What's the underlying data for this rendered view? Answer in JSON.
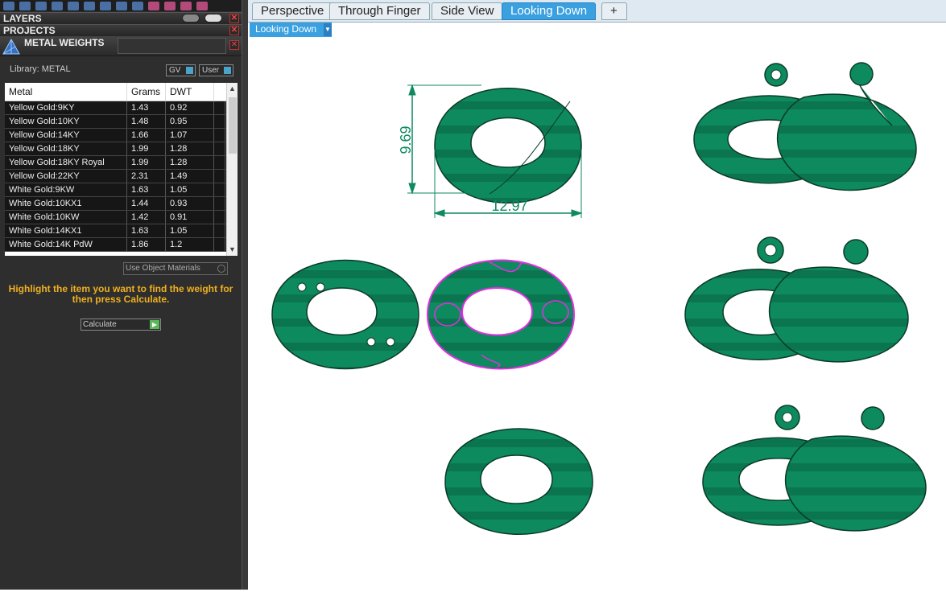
{
  "panels": {
    "layers": "LAYERS",
    "projects": "PROJECTS",
    "metal_weights": "METAL WEIGHTS"
  },
  "library": {
    "label": "Library: METAL",
    "gv": "GV",
    "user": "User"
  },
  "table": {
    "headers": [
      "Metal",
      "Grams",
      "DWT"
    ],
    "rows": [
      [
        "Yellow Gold:9KY",
        "1.43",
        "0.92"
      ],
      [
        "Yellow Gold:10KY",
        "1.48",
        "0.95"
      ],
      [
        "Yellow Gold:14KY",
        "1.66",
        "1.07"
      ],
      [
        "Yellow Gold:18KY",
        "1.99",
        "1.28"
      ],
      [
        "Yellow Gold:18KY Royal",
        "1.99",
        "1.28"
      ],
      [
        "Yellow Gold:22KY",
        "2.31",
        "1.49"
      ],
      [
        "White Gold:9KW",
        "1.63",
        "1.05"
      ],
      [
        "White Gold:10KX1",
        "1.44",
        "0.93"
      ],
      [
        "White Gold:10KW",
        "1.42",
        "0.91"
      ],
      [
        "White Gold:14KX1",
        "1.63",
        "1.05"
      ],
      [
        "White Gold:14K PdW",
        "1.86",
        "1.2"
      ]
    ]
  },
  "use_object_materials": "Use Object Materials",
  "hint": "Highlight the item you want to find the weight for then press Calculate.",
  "calculate": "Calculate",
  "tabs": [
    "Perspective",
    "Through Finger",
    "Side View",
    "Looking Down"
  ],
  "add_tab": "+",
  "active_view": "Looking Down",
  "dimensions": {
    "height": "9.69",
    "width": "12.97"
  },
  "colors": {
    "model_green": "#0e8a5f",
    "selection": "#e030e0",
    "accent": "#3aa0e0"
  }
}
